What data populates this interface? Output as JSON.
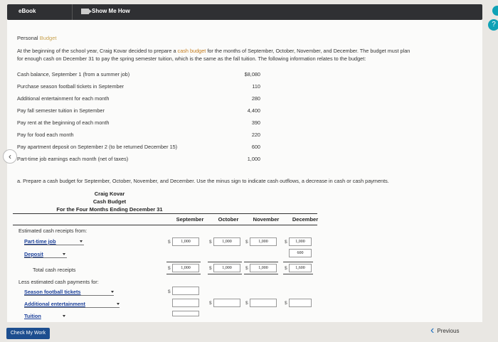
{
  "topbar": {
    "ebook_label": "eBook",
    "showme_label": "Show Me How"
  },
  "problem": {
    "title_prefix": "Personal ",
    "title_accent": "Budget",
    "intro_line1_a": "At the beginning of the school year, Craig Kovar decided to prepare a ",
    "intro_link": "cash budget",
    "intro_line1_b": " for the months of September, October, November, and December. The budget must plan",
    "intro_line2": "for enough cash on December 31 to pay the spring semester tuition, which is the same as the fall tuition. The following information relates to the budget:",
    "items": [
      {
        "label": "Cash balance, September 1 (from a summer job)",
        "value": "$8,080"
      },
      {
        "label": "Purchase season football tickets in September",
        "value": "110"
      },
      {
        "label": "Additional entertainment for each month",
        "value": "280"
      },
      {
        "label": "Pay fall semester tuition in September",
        "value": "4,400"
      },
      {
        "label": "Pay rent at the beginning of each month",
        "value": "390"
      },
      {
        "label": "Pay for food each month",
        "value": "220"
      },
      {
        "label": "Pay apartment deposit on September 2 (to be returned December 15)",
        "value": "600"
      },
      {
        "label": "Part-time job earnings each month (net of taxes)",
        "value": "1,000"
      }
    ],
    "part_a": "a.  Prepare a cash budget for September, October, November, and December. Use the minus sign to indicate cash outflows, a decrease in cash or cash payments."
  },
  "budget": {
    "name": "Craig Kovar",
    "title": "Cash Budget",
    "period": "For the Four Months Ending December 31",
    "columns": [
      "September",
      "October",
      "November",
      "December"
    ],
    "receipts_header": "Estimated cash receipts from:",
    "part_time_select": "Part-time job",
    "part_time_values": [
      "1,000",
      "1,000",
      "1,000",
      "1,000"
    ],
    "deposit_select": "Deposit",
    "deposit_dec_value": "600",
    "total_receipts_label": "Total cash receipts",
    "total_receipts_values": [
      "1,000",
      "1,000",
      "1,000",
      "1,600"
    ],
    "payments_header": "Less estimated cash payments for:",
    "football_select": "Season football tickets",
    "entertainment_select": "Additional entertainment",
    "tuition_select": "Tuition",
    "dollar": "$"
  },
  "footer": {
    "check_label": "Check My Work",
    "previous_label": "Previous"
  }
}
